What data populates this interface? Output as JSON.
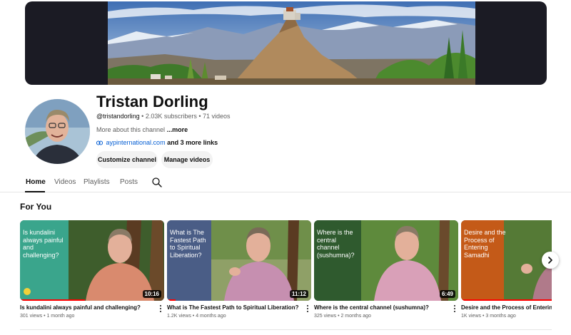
{
  "channel": {
    "name": "Tristan Dorling",
    "handle": "@tristandorling",
    "separator": " • ",
    "subscribers": "2.03K subscribers",
    "videos": "71 videos",
    "about": "More about this channel",
    "about_more": "...more",
    "link_url": "aypinternational.com",
    "link_more": "and 3 more links",
    "buttons": {
      "customize": "Customize channel",
      "manage": "Manage videos"
    }
  },
  "tabs": [
    {
      "label": "Home",
      "active": true
    },
    {
      "label": "Videos",
      "active": false
    },
    {
      "label": "Playlists",
      "active": false
    },
    {
      "label": "Posts",
      "active": false
    }
  ],
  "section": {
    "title": "For You"
  },
  "videos": [
    {
      "overlay_text": "Is kundalini always painful and challenging?",
      "overlay_color": "#3aa58c",
      "title": "Is kundalini always painful and challenging?",
      "meta": "301 views • 1 month ago",
      "duration": "10:16",
      "shirt_color": "#d98a6e"
    },
    {
      "overlay_text": "What is The Fastest Path to Spiritual Liberation?",
      "overlay_color": "#4a5d86",
      "title": "What is The Fastest Path to Spiritual Liberation?",
      "meta": "1.2K views • 4 months ago",
      "duration": "11:12",
      "shirt_color": "#c68fb0"
    },
    {
      "overlay_text": "Where is the central channel (sushumna)?",
      "overlay_color": "#2f5a2e",
      "title": "Where is the central channel (sushumna)?",
      "meta": "325 views • 2 months ago",
      "duration": "6:49",
      "shirt_color": "#d9a0b8"
    },
    {
      "overlay_text": "Desire and the Process of Entering Samadhi",
      "overlay_color": "#c45a18",
      "title": "Desire and the Process of Entering Samadhi",
      "meta": "1K views • 3 months ago",
      "duration": "",
      "shirt_color": "#b07a8a"
    }
  ],
  "icons": {
    "search": "search-icon",
    "link": "link-icon",
    "next": "chevron-right-icon",
    "menu": "more-vert-icon"
  },
  "colors": {
    "link": "#065fd4",
    "progress": "#ff0000",
    "button_bg": "#f2f2f2"
  }
}
